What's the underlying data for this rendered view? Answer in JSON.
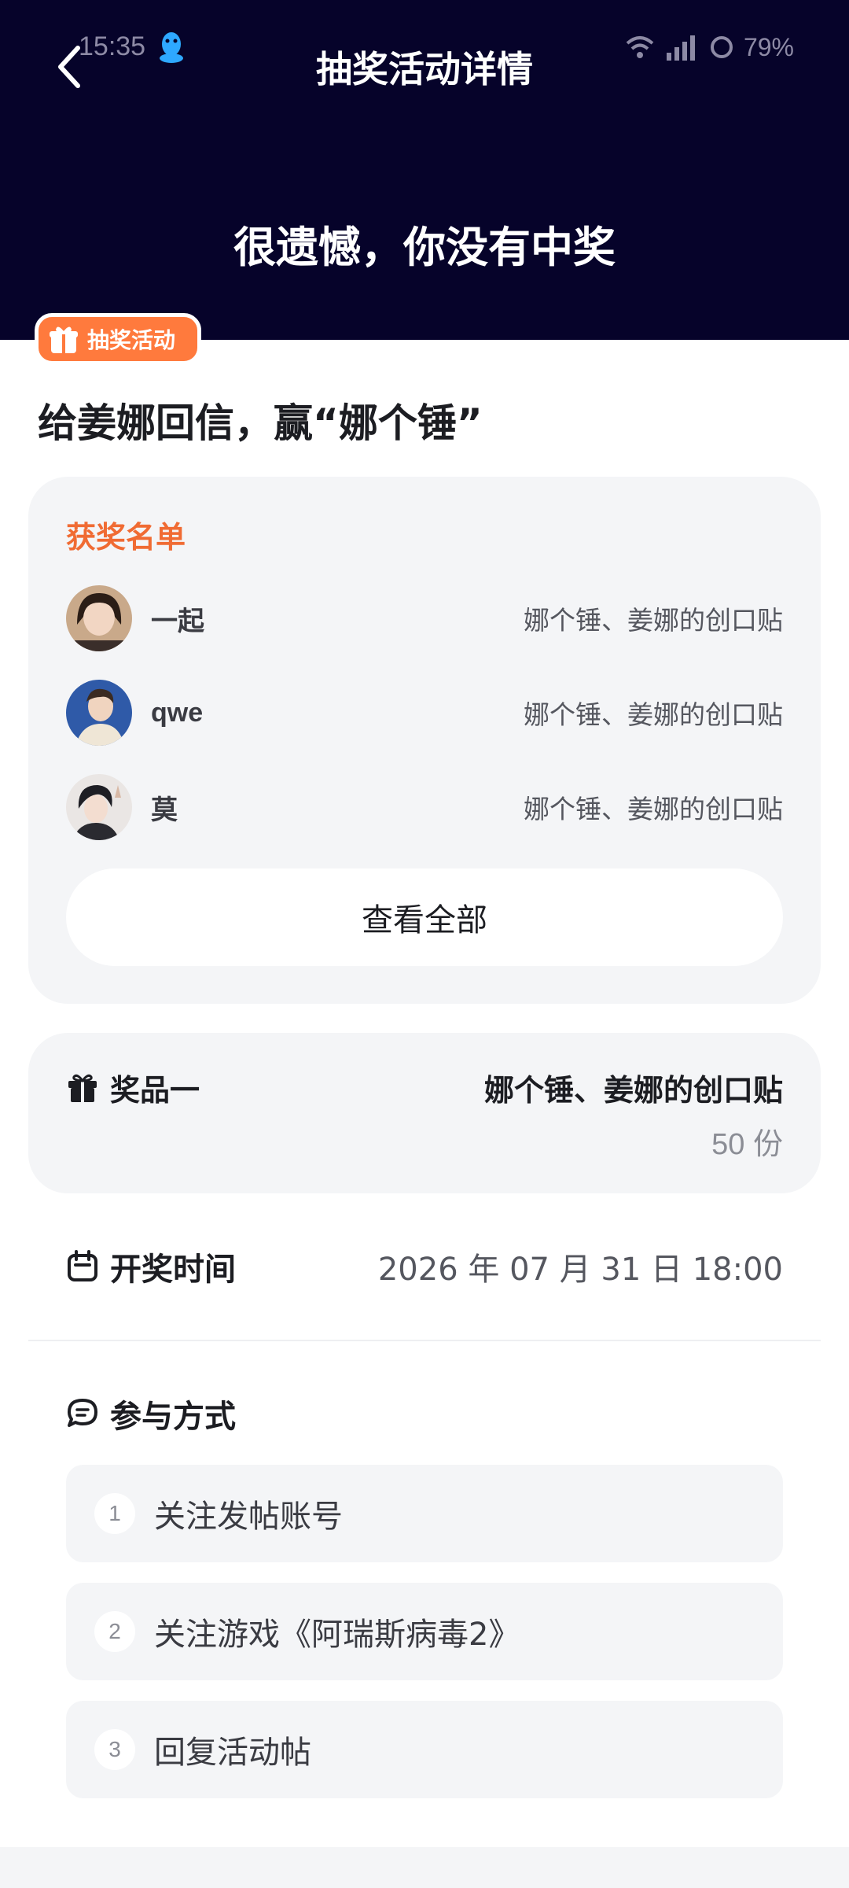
{
  "status_bar": {
    "time": "15:35",
    "battery": "79%"
  },
  "header": {
    "title": "抽奖活动详情",
    "result": "很遗憾，你没有中奖"
  },
  "badge": {
    "label": "抽奖活动"
  },
  "activity": {
    "title": "给姜娜回信，赢“娜个锤”"
  },
  "winners": {
    "title": "获奖名单",
    "rows": [
      {
        "name": "一起",
        "prize": "娜个锤、姜娜的创口贴"
      },
      {
        "name": "qwe",
        "prize": "娜个锤、姜娜的创口贴"
      },
      {
        "name": "莫",
        "prize": "娜个锤、姜娜的创口贴"
      }
    ],
    "view_all": "查看全部"
  },
  "prize": {
    "label": "奖品一",
    "name": "娜个锤、姜娜的创口贴",
    "quantity": "50 份"
  },
  "draw_time": {
    "label": "开奖时间",
    "value": "2026 年 07 月 31 日 18:00"
  },
  "participation": {
    "label": "参与方式",
    "steps": [
      {
        "num": "1",
        "text": "关注发帖账号"
      },
      {
        "num": "2",
        "text": "关注游戏《阿瑞斯病毒2》"
      },
      {
        "num": "3",
        "text": "回复活动帖"
      }
    ]
  },
  "colors": {
    "header_bg": "#06032a",
    "accent_orange": "#ff7a3d",
    "winners_title": "#f06b33",
    "card_bg": "#f4f5f7"
  },
  "icons": [
    "back-icon",
    "qq-icon",
    "wifi-icon",
    "signal-icon",
    "battery-icon",
    "gift-icon",
    "calendar-icon",
    "chat-icon"
  ]
}
